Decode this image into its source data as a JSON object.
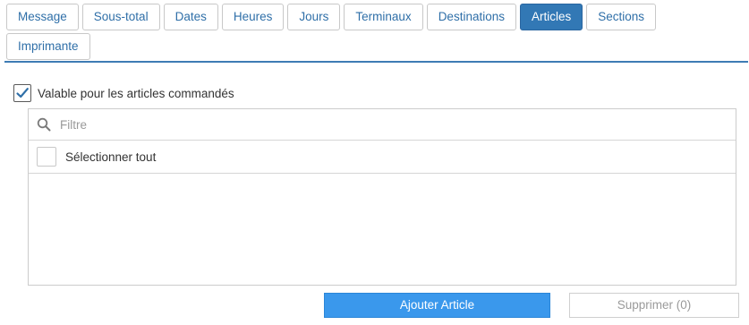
{
  "tabs": {
    "row1": [
      {
        "label": "Message",
        "active": false
      },
      {
        "label": "Sous-total",
        "active": false
      },
      {
        "label": "Dates",
        "active": false
      },
      {
        "label": "Heures",
        "active": false
      },
      {
        "label": "Jours",
        "active": false
      },
      {
        "label": "Terminaux",
        "active": false
      },
      {
        "label": "Destinations",
        "active": false
      },
      {
        "label": "Articles",
        "active": true
      },
      {
        "label": "Sections",
        "active": false
      }
    ],
    "row2": [
      {
        "label": "Imprimante",
        "active": false
      }
    ]
  },
  "valid_option": {
    "label": "Valable pour les articles commandés",
    "checked": true
  },
  "filter": {
    "placeholder": "Filtre",
    "value": "",
    "icon": "search-icon"
  },
  "select_all": {
    "label": "Sélectionner tout",
    "checked": false
  },
  "items": [],
  "buttons": {
    "add_label": "Ajouter Article",
    "delete_label": "Supprimer (0)"
  },
  "colors": {
    "accent": "#3278b5",
    "add_button": "#3a98ec",
    "tab_text": "#2f6fa8"
  }
}
